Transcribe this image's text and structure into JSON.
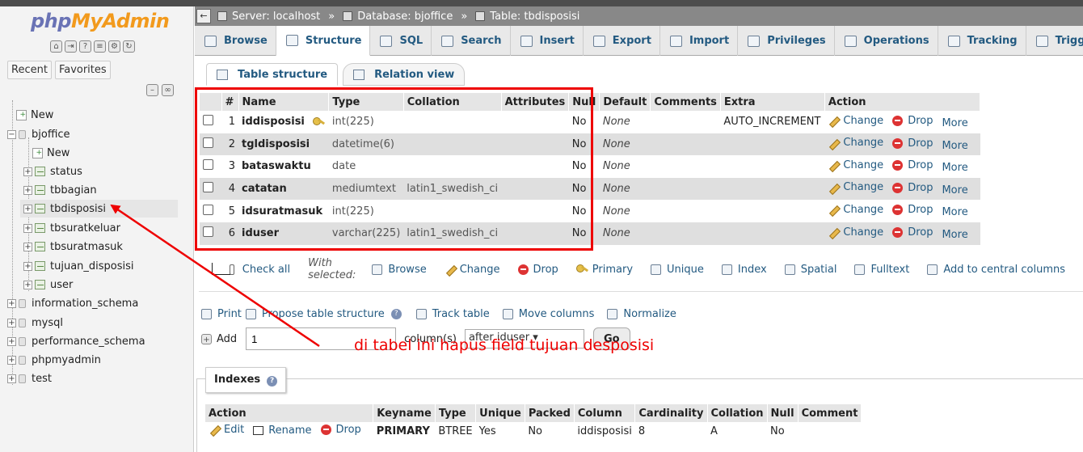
{
  "logo": {
    "part1": "php",
    "part2": "MyAdmin"
  },
  "nav": {
    "recent": "Recent",
    "favorites": "Favorites",
    "tree": [
      {
        "label": "New",
        "kind": "new"
      },
      {
        "label": "bjoffice",
        "kind": "db"
      },
      {
        "label": "New",
        "kind": "new"
      },
      {
        "label": "status",
        "kind": "table"
      },
      {
        "label": "tbbagian",
        "kind": "table"
      },
      {
        "label": "tbdisposisi",
        "kind": "table",
        "selected": true
      },
      {
        "label": "tbsuratkeluar",
        "kind": "table"
      },
      {
        "label": "tbsuratmasuk",
        "kind": "table"
      },
      {
        "label": "tujuan_disposisi",
        "kind": "table"
      },
      {
        "label": "user",
        "kind": "table"
      },
      {
        "label": "information_schema",
        "kind": "db"
      },
      {
        "label": "mysql",
        "kind": "db"
      },
      {
        "label": "performance_schema",
        "kind": "db"
      },
      {
        "label": "phpmyadmin",
        "kind": "db"
      },
      {
        "label": "test",
        "kind": "db"
      }
    ]
  },
  "breadcrumb": {
    "server": "Server: localhost",
    "database": "Database: bjoffice",
    "table": "Table: tbdisposisi",
    "sep": "»"
  },
  "topmenu": [
    "Browse",
    "Structure",
    "SQL",
    "Search",
    "Insert",
    "Export",
    "Import",
    "Privileges",
    "Operations",
    "Tracking",
    "Triggers"
  ],
  "subtabs": {
    "structure": "Table structure",
    "relation": "Relation view"
  },
  "structure": {
    "headers": [
      "#",
      "Name",
      "Type",
      "Collation",
      "Attributes",
      "Null",
      "Default",
      "Comments",
      "Extra",
      "Action"
    ],
    "rows": [
      {
        "num": "1",
        "name": "iddisposisi",
        "type": "int(225)",
        "collation": "",
        "attributes": "",
        "null": "No",
        "default": "None",
        "comments": "",
        "extra": "AUTO_INCREMENT",
        "primary": true
      },
      {
        "num": "2",
        "name": "tgldisposisi",
        "type": "datetime(6)",
        "collation": "",
        "attributes": "",
        "null": "No",
        "default": "None",
        "comments": "",
        "extra": ""
      },
      {
        "num": "3",
        "name": "bataswaktu",
        "type": "date",
        "collation": "",
        "attributes": "",
        "null": "No",
        "default": "None",
        "comments": "",
        "extra": ""
      },
      {
        "num": "4",
        "name": "catatan",
        "type": "mediumtext",
        "collation": "latin1_swedish_ci",
        "attributes": "",
        "null": "No",
        "default": "None",
        "comments": "",
        "extra": ""
      },
      {
        "num": "5",
        "name": "idsuratmasuk",
        "type": "int(225)",
        "collation": "",
        "attributes": "",
        "null": "No",
        "default": "None",
        "comments": "",
        "extra": ""
      },
      {
        "num": "6",
        "name": "iduser",
        "type": "varchar(225)",
        "collation": "latin1_swedish_ci",
        "attributes": "",
        "null": "No",
        "default": "None",
        "comments": "",
        "extra": ""
      }
    ],
    "actions": {
      "change": "Change",
      "drop": "Drop",
      "more": "More"
    }
  },
  "actionbar": {
    "check_all": "Check all",
    "with_selected": "With selected:",
    "items": [
      "Browse",
      "Change",
      "Drop",
      "Primary",
      "Unique",
      "Index",
      "Spatial",
      "Fulltext",
      "Add to central columns"
    ]
  },
  "printbar": {
    "print": "Print",
    "propose": "Propose table structure",
    "track": "Track table",
    "move": "Move columns",
    "normalize": "Normalize"
  },
  "addcol": {
    "label": "Add",
    "value": "1",
    "columns": "column(s)",
    "position": "after iduser",
    "go": "Go"
  },
  "annotation": "di tabel ini hapus field tujuan desposisi",
  "indexes": {
    "title": "Indexes",
    "headers": [
      "Action",
      "Keyname",
      "Type",
      "Unique",
      "Packed",
      "Column",
      "Cardinality",
      "Collation",
      "Null",
      "Comment"
    ],
    "row": {
      "edit": "Edit",
      "rename": "Rename",
      "drop": "Drop",
      "keyname": "PRIMARY",
      "type": "BTREE",
      "unique": "Yes",
      "packed": "No",
      "column": "iddisposisi",
      "cardinality": "8",
      "collation": "A",
      "null": "No",
      "comment": ""
    }
  },
  "colors": {
    "accent": "#235a81",
    "annotation": "#e00000",
    "breadcrumb": "#888888"
  }
}
